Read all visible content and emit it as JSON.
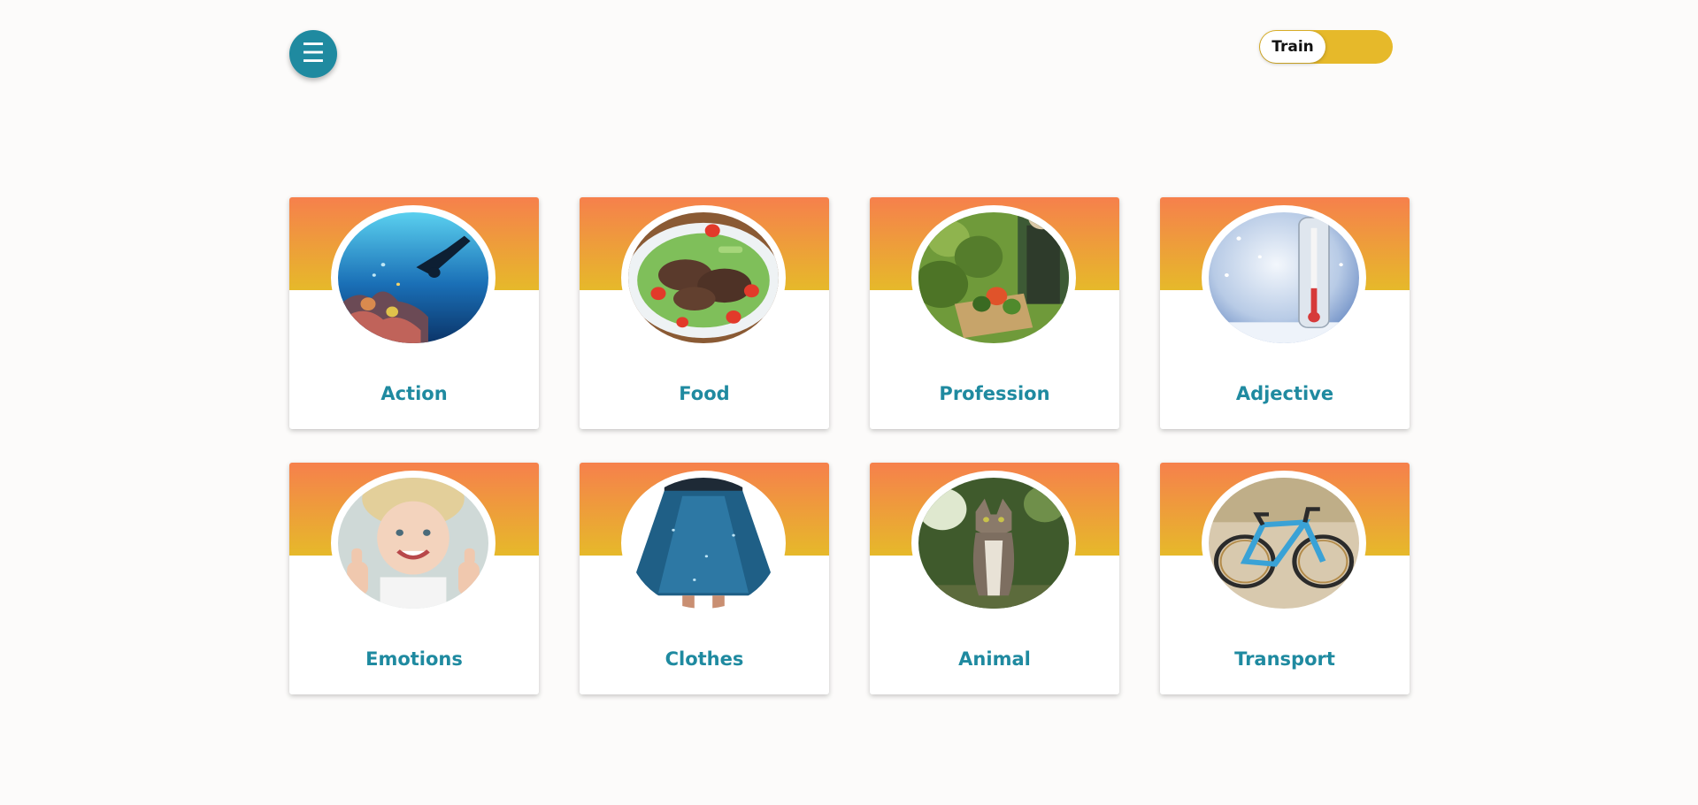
{
  "header": {
    "menu_icon_glyph": "☰",
    "mode_toggle_label": "Train"
  },
  "colors": {
    "primary": "#1f8aa0",
    "accent": "#e6b92a",
    "banner_top": "#f6804c",
    "banner_bottom": "#e6b92a",
    "background": "#fcfbfa"
  },
  "categories": [
    {
      "label": "Action",
      "image": "scuba-diver-coral-reef"
    },
    {
      "label": "Food",
      "image": "grilled-meat-salad-plate"
    },
    {
      "label": "Profession",
      "image": "farmer-harvesting-vegetables"
    },
    {
      "label": "Adjective",
      "image": "thermometer-in-snow"
    },
    {
      "label": "Emotions",
      "image": "smiling-girl-thumbs-up"
    },
    {
      "label": "Clothes",
      "image": "blue-sparkly-skirt"
    },
    {
      "label": "Animal",
      "image": "tabby-cat-sitting"
    },
    {
      "label": "Transport",
      "image": "blue-gravel-bicycle"
    }
  ]
}
